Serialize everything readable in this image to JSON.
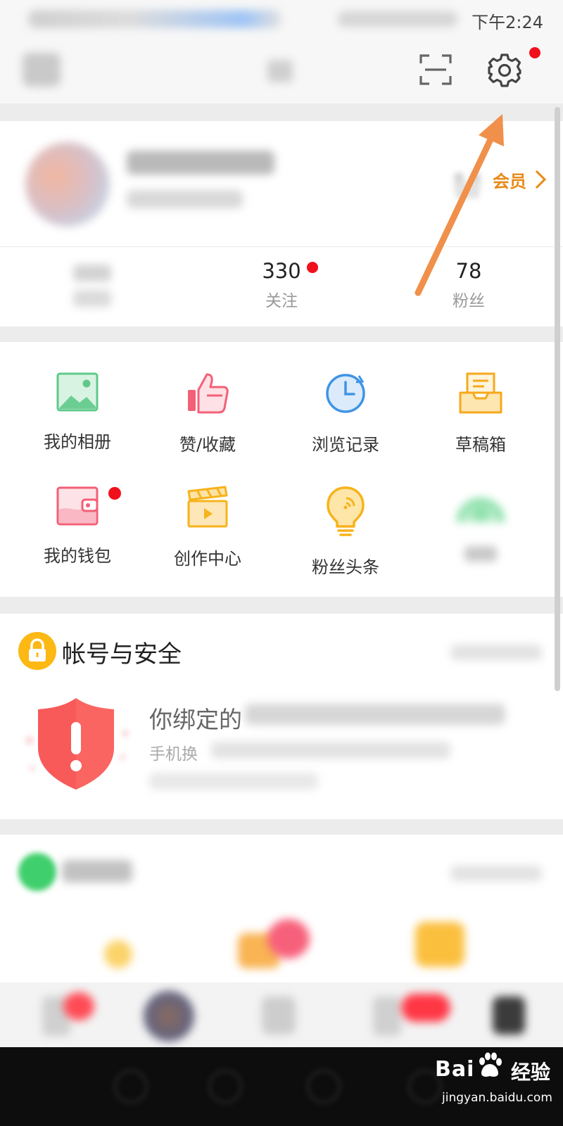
{
  "status_bar": {
    "time": "下午2:24"
  },
  "top_nav": {
    "has_settings_badge": true
  },
  "profile": {
    "vip_label": "会员",
    "stats": [
      {
        "value": "330",
        "label": "关注",
        "has_badge": true
      },
      {
        "value": "78",
        "label": "粉丝",
        "has_badge": false
      }
    ]
  },
  "grid": {
    "items": [
      {
        "label": "我的相册",
        "icon": "photo-album-icon"
      },
      {
        "label": "赞/收藏",
        "icon": "thumbs-up-icon"
      },
      {
        "label": "浏览记录",
        "icon": "history-clock-icon"
      },
      {
        "label": "草稿箱",
        "icon": "draft-box-icon"
      },
      {
        "label": "我的钱包",
        "icon": "wallet-icon",
        "has_badge": true
      },
      {
        "label": "创作中心",
        "icon": "clapperboard-icon"
      },
      {
        "label": "粉丝头条",
        "icon": "lightbulb-icon"
      }
    ]
  },
  "security": {
    "title": "帐号与安全",
    "line1": "你绑定的",
    "line2": "手机换"
  },
  "watermark": {
    "brand_left": "Bai",
    "brand_right": "经验",
    "url": "jingyan.baidu.com"
  },
  "colors": {
    "badge_red": "#f0101b",
    "vip_orange": "#e88a18",
    "arrow_orange": "#f0904a",
    "lock_yellow": "#fcb813",
    "shield_red": "#f75a58"
  }
}
